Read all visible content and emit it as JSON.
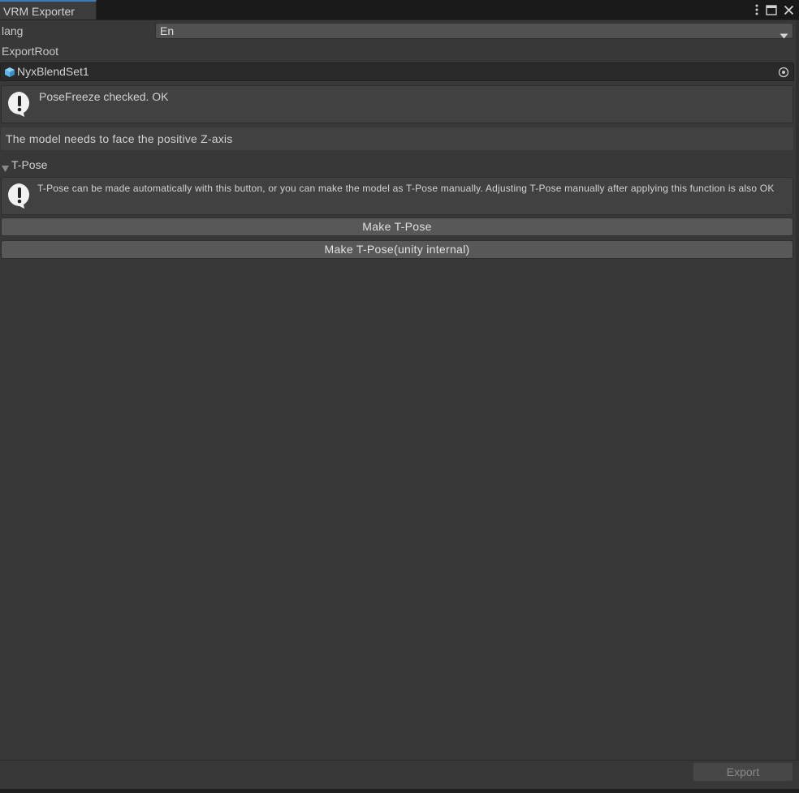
{
  "window": {
    "tab_title": "VRM Exporter",
    "tab_icons": [
      "more-vert-icon",
      "maximize-icon",
      "close-icon"
    ]
  },
  "settings": {
    "lang_label": "lang",
    "lang_value": "En",
    "export_root_label": "ExportRoot",
    "export_root_value": "NyxBlendSet1"
  },
  "messages": {
    "pose_freeze": "PoseFreeze checked. OK",
    "face_axis": "The model needs to face the positive Z-axis"
  },
  "tpose": {
    "foldout_label": "T-Pose",
    "help_text": "T-Pose can be made automatically with this button, or you can make the model as T-Pose manually. Adjusting T-Pose manually after applying this function is also OK",
    "make_tpose_label": "Make T-Pose",
    "make_tpose_internal_label": "Make T-Pose(unity internal)"
  },
  "footer": {
    "export_label": "Export"
  },
  "colors": {
    "tab_accent": "#3a79bb",
    "background": "#383838",
    "button": "#585858",
    "helpbox": "#414141",
    "prefab_icon": "#5fb4e8"
  }
}
